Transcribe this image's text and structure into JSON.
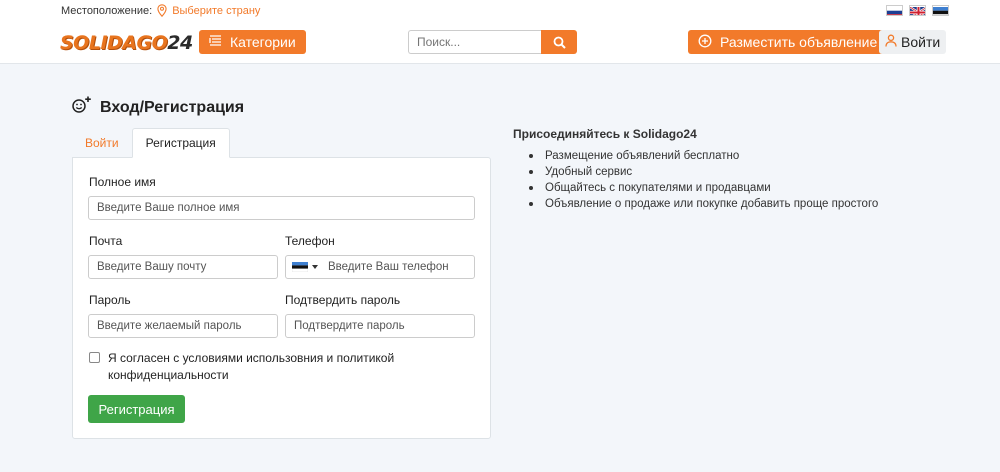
{
  "header": {
    "location_label": "Местоположение:",
    "location_value": "Выберите страну",
    "logo_main": "SOLIDAGO",
    "logo_num": "24",
    "categories_label": "Категории",
    "search_placeholder": "Поиск...",
    "post_ad_label": "Разместить объявление",
    "login_label": "Войти",
    "languages": [
      "ru",
      "en",
      "et"
    ]
  },
  "page": {
    "title": "Вход/Регистрация"
  },
  "tabs": [
    {
      "label": "Войти",
      "active": false
    },
    {
      "label": "Регистрация",
      "active": true
    }
  ],
  "form": {
    "fullname_label": "Полное имя",
    "fullname_placeholder": "Введите Ваше полное имя",
    "email_label": "Почта",
    "email_placeholder": "Введите Вашу почту",
    "phone_label": "Телефон",
    "phone_placeholder": "Введите Ваш телефон",
    "password_label": "Пароль",
    "password_placeholder": "Введите желаемый пароль",
    "confirm_label": "Подтвердить пароль",
    "confirm_placeholder": "Подтвердите пароль",
    "agree_line1": "Я согласен с условиями использовния и политикой",
    "agree_line2": "конфиденциальности",
    "agree_checked": false,
    "submit_label": "Регистрация"
  },
  "join": {
    "title": "Присоединяйтесь к Solidago24",
    "items": [
      "Размещение объявлений бесплатно",
      "Удобный сервис",
      "Общайтесь с покупателями и продавцами",
      "Объявление о продаже или покупке добавить проще простого"
    ]
  },
  "colors": {
    "accent": "#f27a2a",
    "success": "#3fa548",
    "background": "#f3f6fa"
  }
}
